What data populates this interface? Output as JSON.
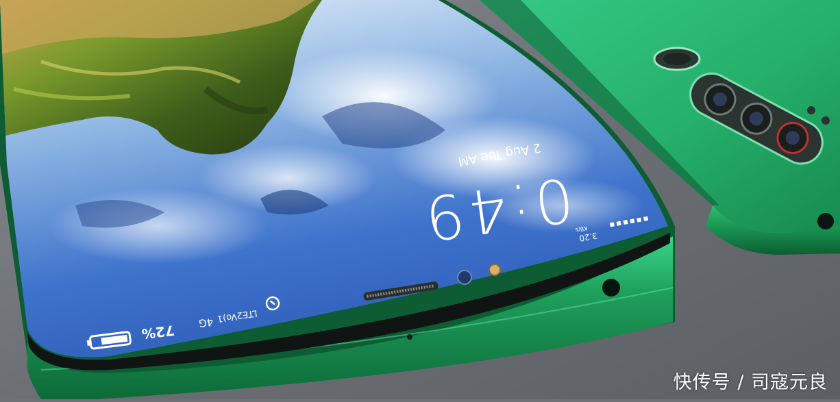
{
  "lockscreen": {
    "time": "0:49",
    "date": "2 Aug Tue AM",
    "battery": "72%",
    "network": "4G",
    "lte": "LTE2",
    "volte": "Vo)1",
    "speed": "3.20",
    "speed_unit": "KB/s"
  },
  "watermark": "快传号 / 司寇元良",
  "colors": {
    "body_green": "#1f9a5a",
    "body_green_dark": "#0f6a3a",
    "back_green": "#27b46f",
    "table": "#6e7176"
  }
}
